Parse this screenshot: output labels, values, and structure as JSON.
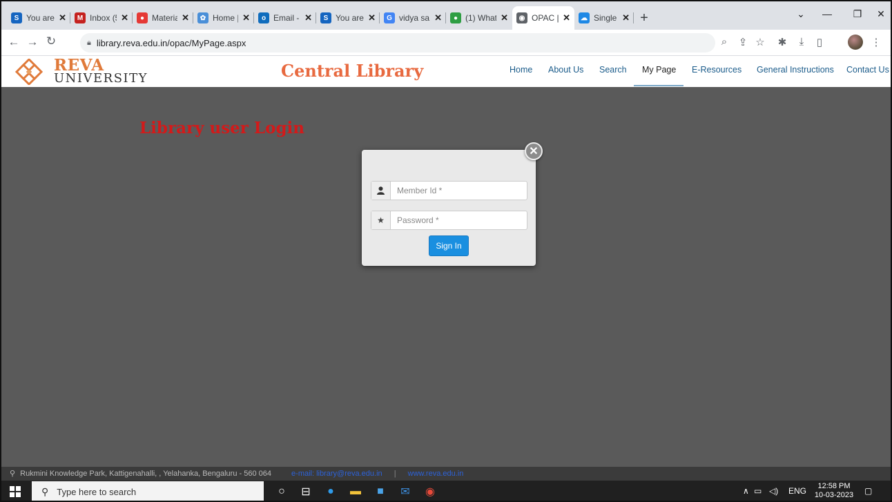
{
  "browser": {
    "tabs": [
      {
        "label": "You are",
        "favicon": "S",
        "color": "#1565c0",
        "active": false
      },
      {
        "label": "Inbox (5",
        "favicon": "M",
        "color": "#c5221f",
        "active": false
      },
      {
        "label": "Materia",
        "favicon": "●",
        "color": "#e53935",
        "active": false
      },
      {
        "label": "Home |",
        "favicon": "✿",
        "color": "#4a8fd8",
        "active": false
      },
      {
        "label": "Email - (",
        "favicon": "o",
        "color": "#0f6cbd",
        "active": false
      },
      {
        "label": "You are",
        "favicon": "S",
        "color": "#1565c0",
        "active": false
      },
      {
        "label": "vidya sa",
        "favicon": "G",
        "color": "#4285f4",
        "active": false
      },
      {
        "label": "(1) What",
        "favicon": "●",
        "color": "#2e9e43",
        "active": false
      },
      {
        "label": "OPAC |",
        "favicon": "◉",
        "color": "#5f6368",
        "active": true
      },
      {
        "label": "Single S",
        "favicon": "☁",
        "color": "#1e88e5",
        "active": false
      }
    ],
    "tab_close": "✕",
    "new_tab": "+",
    "url": "library.reva.edu.in/opac/MyPage.aspx"
  },
  "site": {
    "brand_line1": "REVA",
    "brand_line2": "UNIVERSITY",
    "title": "Central Library",
    "nav": [
      {
        "label": "Home",
        "active": false
      },
      {
        "label": "About Us",
        "active": false
      },
      {
        "label": "Search",
        "active": false
      },
      {
        "label": "My Page",
        "active": true
      },
      {
        "label": "E-Resources",
        "active": false
      },
      {
        "label": "General Instructions",
        "active": false
      },
      {
        "label": "Contact Us",
        "active": false
      }
    ]
  },
  "login": {
    "heading": "Library user Login",
    "member_placeholder": "Member Id *",
    "member_value": "",
    "password_placeholder": "Password *",
    "password_value": "",
    "signin_label": "Sign In",
    "close_glyph": "✕"
  },
  "footer": {
    "address": "Rukmini Knowledge Park, Kattigenahalli, , Yelahanka,  Bengaluru - 560 064",
    "email": "e-mail: library@reva.edu.in",
    "separator": "|",
    "website": "www.reva.edu.in"
  },
  "taskbar": {
    "search_placeholder": "Type here to search",
    "language": "ENG",
    "time": "12:58 PM",
    "date": "10-03-2023"
  },
  "colors": {
    "brand_orange": "#e86a40",
    "heading_red": "#d21a1a",
    "nav_blue": "#1a5b8a",
    "signin_blue": "#1a8fe0",
    "page_gray": "#5a5a5a"
  },
  "icons": {
    "back": "back-arrow-icon",
    "forward": "forward-arrow-icon",
    "reload": "reload-icon",
    "lock": "lock-icon",
    "member": "user-icon",
    "password": "star-icon",
    "footer": "map-pin-icon"
  }
}
